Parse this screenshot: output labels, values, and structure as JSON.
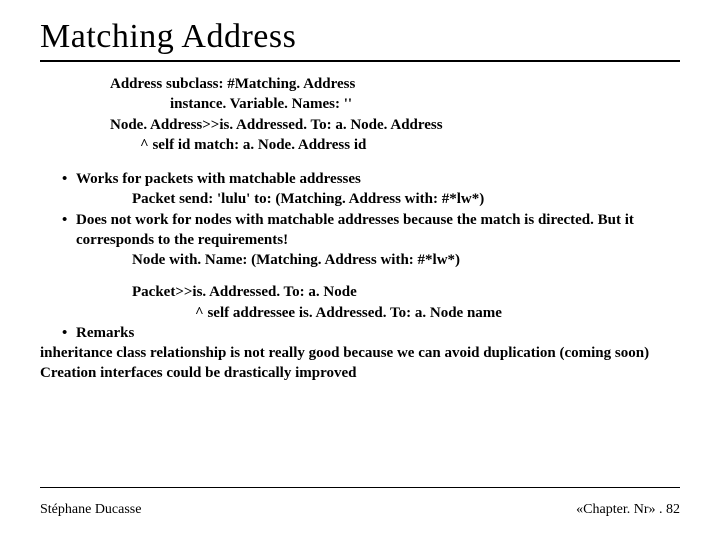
{
  "title": "Matching Address",
  "code": {
    "l1": "Address subclass: #Matching. Address",
    "l2": "instance. Variable. Names: ''",
    "l3": "Node. Address>>is. Addressed. To: a. Node. Address",
    "l4": "^ self id match: a. Node. Address id"
  },
  "b1": {
    "text": "Works for packets with matchable addresses",
    "sub": "Packet send: 'lulu' to: (Matching. Address with: #*lw*)"
  },
  "b2": {
    "text": "Does not work for nodes with matchable addresses because the match is directed. But it corresponds to the requirements!",
    "sub": "Node with. Name: (Matching. Address with: #*lw*)"
  },
  "code2": {
    "l1": "Packet>>is. Addressed. To: a. Node",
    "l2": "^ self addressee is. Addressed. To: a. Node name"
  },
  "b3": {
    "text": "Remarks"
  },
  "p1": "inheritance class relationship is not really good because we can avoid duplication (coming soon)",
  "p2": "Creation interfaces could be drastically improved",
  "footer": {
    "left": "Stéphane Ducasse",
    "right": "«Chapter. Nr» . 82"
  }
}
